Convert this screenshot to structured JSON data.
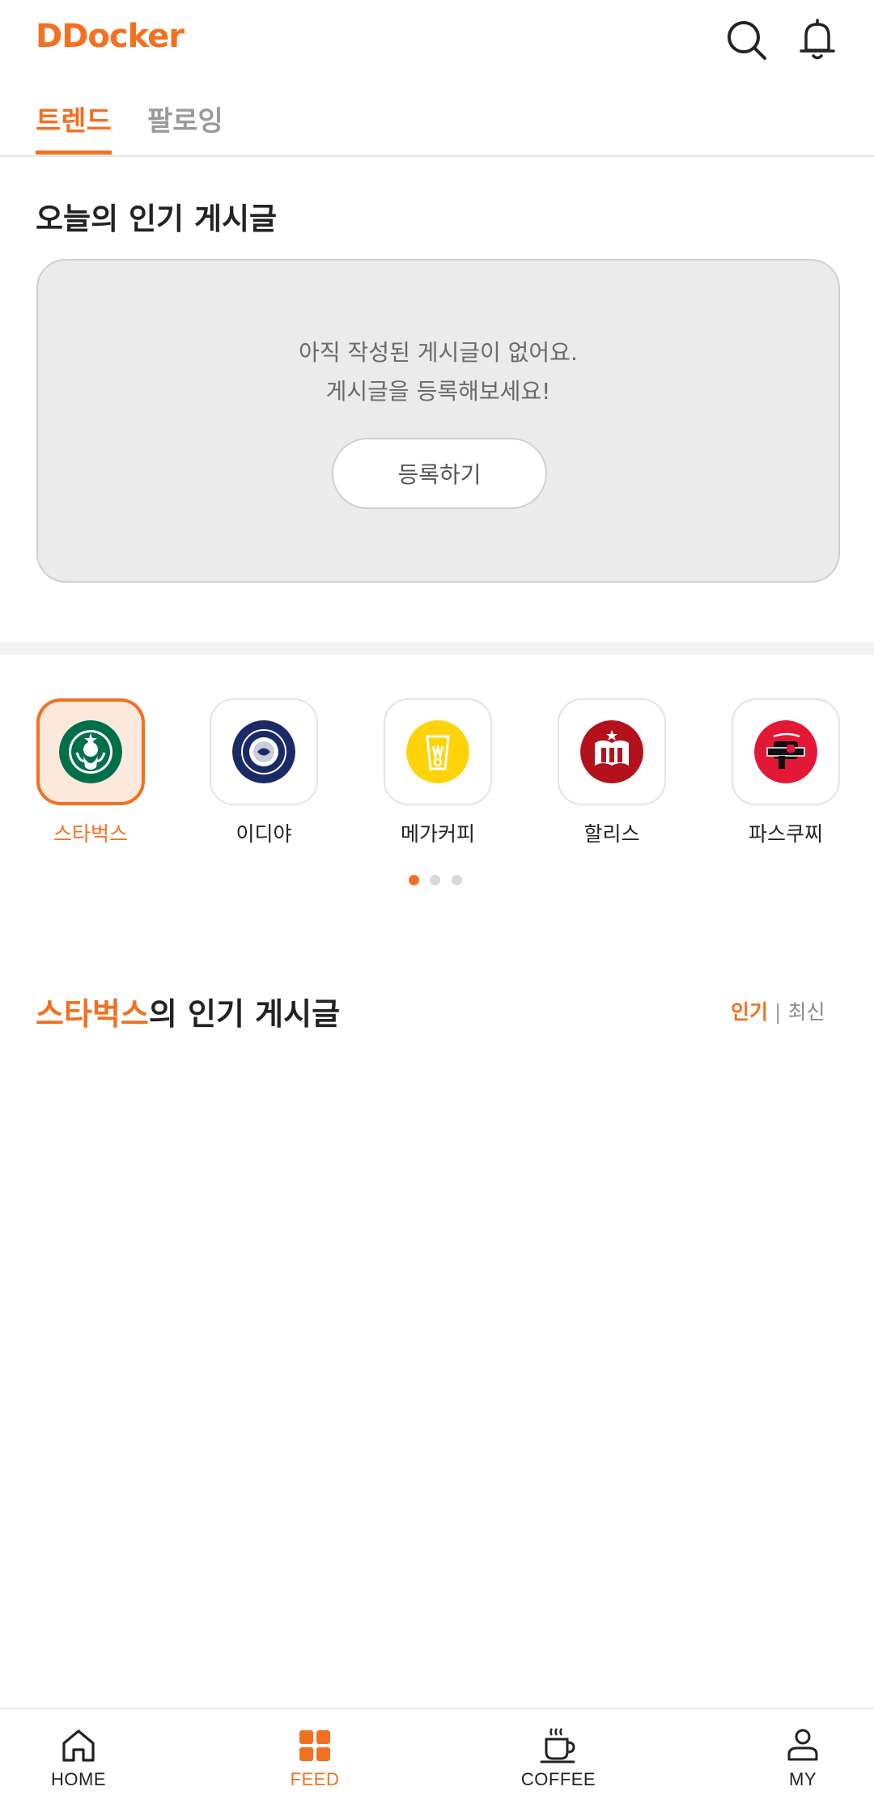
{
  "app": {
    "logo": "DDocker"
  },
  "header": {
    "icons": [
      "search-icon",
      "bell-icon"
    ]
  },
  "tabs": [
    {
      "label": "트렌드",
      "active": true
    },
    {
      "label": "팔로잉",
      "active": false
    }
  ],
  "today": {
    "title": "오늘의 인기 게시글",
    "empty_line1": "아직 작성된 게시글이 없어요.",
    "empty_line2": "게시글을 등록해보세요!",
    "register_label": "등록하기"
  },
  "brands": [
    {
      "label": "스타벅스",
      "active": true
    },
    {
      "label": "이디야",
      "active": false
    },
    {
      "label": "메가커피",
      "active": false
    },
    {
      "label": "할리스",
      "active": false
    },
    {
      "label": "파스쿠찌",
      "active": false
    }
  ],
  "pagination": {
    "total": 3,
    "current": 1
  },
  "popular": {
    "brand": "스타벅스",
    "suffix": "의 인기 게시글",
    "sort_active": "인기",
    "sort_separator": "|",
    "sort_inactive": "최신"
  },
  "bottom_nav": [
    {
      "label": "HOME",
      "icon": "home-icon",
      "active": false
    },
    {
      "label": "FEED",
      "icon": "grid-icon",
      "active": true
    },
    {
      "label": "COFFEE",
      "icon": "coffee-cup-icon",
      "active": false
    },
    {
      "label": "MY",
      "icon": "user-icon",
      "active": false
    }
  ],
  "colors": {
    "accent": "#F37021",
    "card_bg": "#EBEBEB",
    "active_brand_bg": "#FDE8DC"
  }
}
